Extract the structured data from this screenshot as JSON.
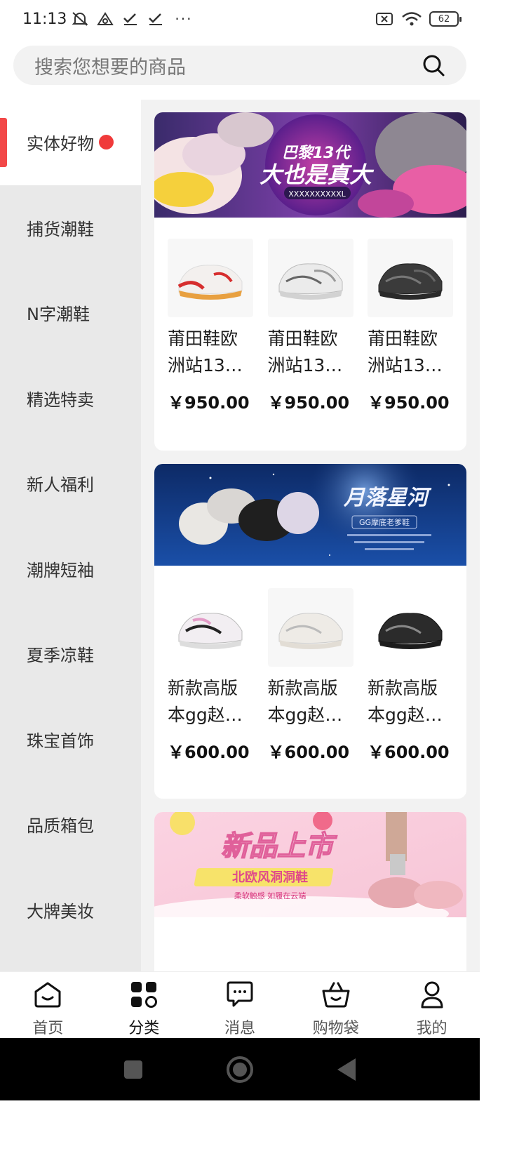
{
  "status_bar": {
    "time": "11:13",
    "battery": "62",
    "dots": "···"
  },
  "search": {
    "placeholder": "搜索您想要的商品"
  },
  "sidebar": {
    "items": [
      {
        "label": "实体好物",
        "active": true
      },
      {
        "label": "捕货潮鞋"
      },
      {
        "label": "N字潮鞋"
      },
      {
        "label": "精选特卖"
      },
      {
        "label": "新人福利"
      },
      {
        "label": "潮牌短袖"
      },
      {
        "label": "夏季凉鞋"
      },
      {
        "label": "珠宝首饰"
      },
      {
        "label": "品质箱包"
      },
      {
        "label": "大牌美妆"
      }
    ]
  },
  "cards": [
    {
      "banner": {
        "line1": "巴黎13代",
        "line2": "大也是真大",
        "line3": "XXXXXXXXXXL"
      },
      "products": [
        {
          "name": "莆田鞋欧洲站13…",
          "price": "￥950.00",
          "color": "red"
        },
        {
          "name": "莆田鞋欧洲站13…",
          "price": "￥950.00",
          "color": "grey"
        },
        {
          "name": "莆田鞋欧洲站13…",
          "price": "￥950.00",
          "color": "black"
        }
      ]
    },
    {
      "banner": {
        "title": "月落星河",
        "subtitle": "GG摩底老爹鞋"
      },
      "products": [
        {
          "name": "新款高版本gg赵…",
          "price": "￥600.00",
          "color": "pink"
        },
        {
          "name": "新款高版本gg赵…",
          "price": "￥600.00",
          "color": "white"
        },
        {
          "name": "新款高版本gg赵…",
          "price": "￥600.00",
          "color": "black"
        }
      ]
    },
    {
      "banner": {
        "title": "新品上市",
        "subtitle": "北欧风洞洞鞋",
        "tagline": "柔软触感 如履在云端"
      }
    }
  ],
  "bottom_nav": {
    "items": [
      {
        "label": "首页",
        "icon": "home-icon"
      },
      {
        "label": "分类",
        "icon": "category-icon",
        "active": true
      },
      {
        "label": "消息",
        "icon": "message-icon"
      },
      {
        "label": "购物袋",
        "icon": "basket-icon"
      },
      {
        "label": "我的",
        "icon": "profile-icon"
      }
    ]
  },
  "colors": {
    "accent": "#f24848",
    "sidebar_bg": "#e9e9e9",
    "content_bg": "#f2f2f2"
  }
}
